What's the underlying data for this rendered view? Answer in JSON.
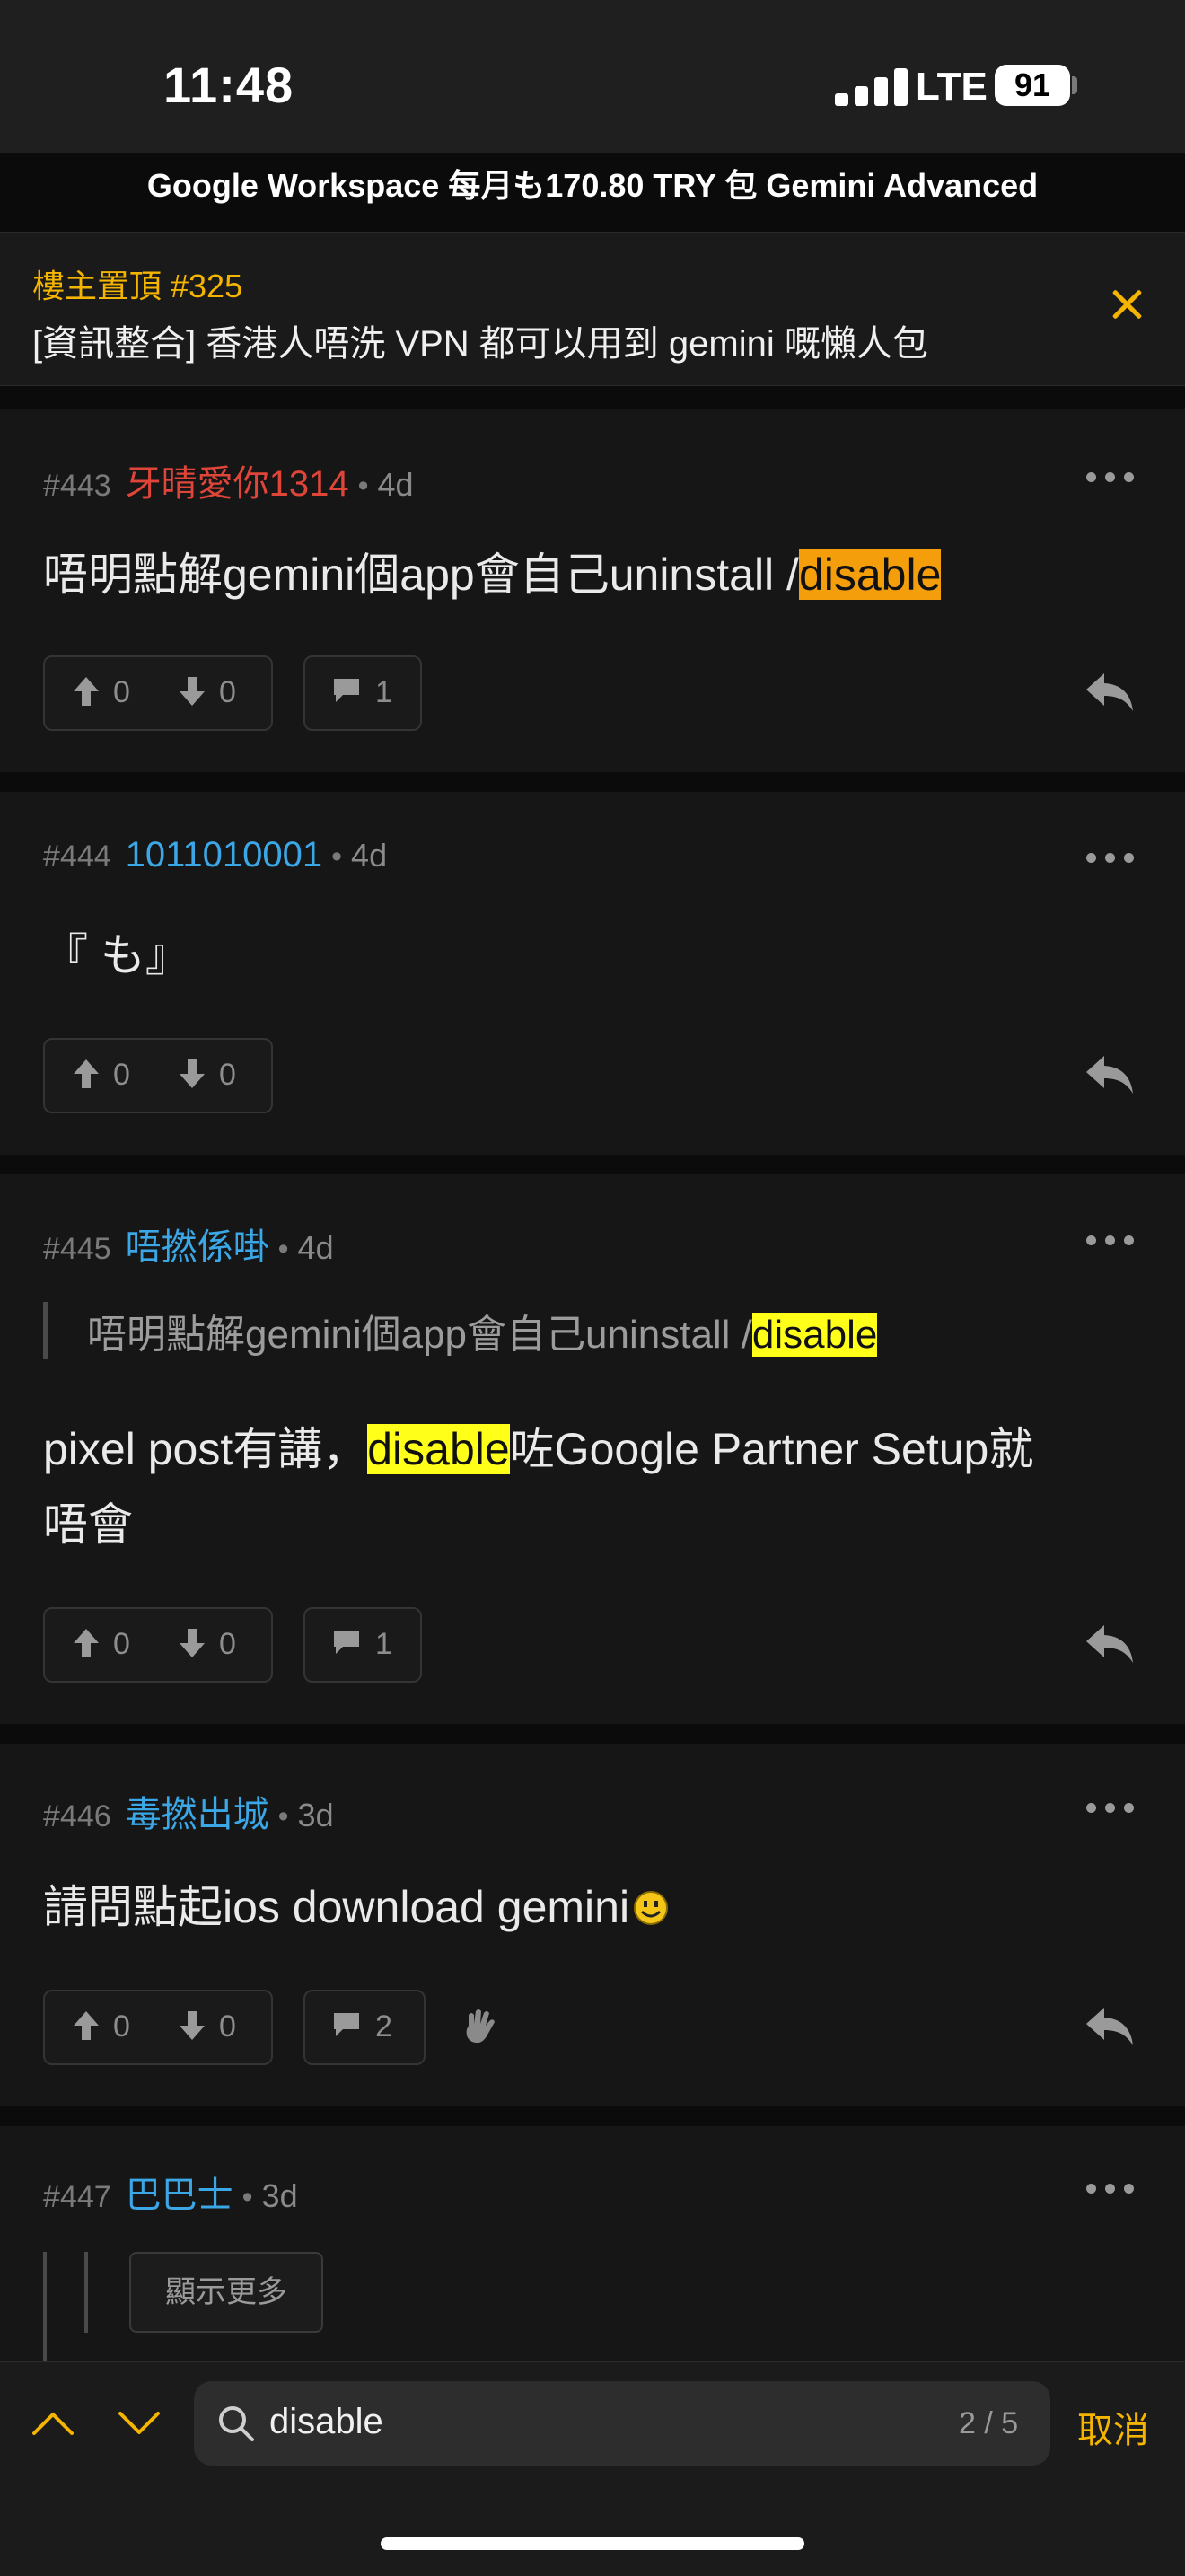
{
  "status": {
    "time": "11:48",
    "network": "LTE",
    "battery": "91"
  },
  "header": {
    "title": "Google Workspace 每月も170.80 TRY 包 Gemini Advanced"
  },
  "pinned": {
    "label": "樓主置頂 #325",
    "text": "[資訊整合] 香港人唔洗 VPN 都可以用到 gemini 嘅懶人包"
  },
  "posts": [
    {
      "num": "#443",
      "user": "牙晴愛你1314",
      "age": "4d",
      "body_pre": "唔明點解gemini個app會自己uninstall /",
      "body_hl": "disable",
      "up": "0",
      "down": "0",
      "comments": "1"
    },
    {
      "num": "#444",
      "user": "1011010001",
      "age": "4d",
      "body": "『 も』",
      "up": "0",
      "down": "0"
    },
    {
      "num": "#445",
      "user": "唔撚係啩",
      "age": "4d",
      "quote_pre": "唔明點解gemini個app會自己uninstall /",
      "quote_hl": "disable",
      "body_pre": "pixel post有講，",
      "body_hl": "disable",
      "body_post": "咗Google Partner Setup就",
      "body_line2": "唔會",
      "up": "0",
      "down": "0",
      "comments": "1"
    },
    {
      "num": "#446",
      "user": "毒撚出城",
      "age": "3d",
      "body": "請問點起ios download gemini",
      "up": "0",
      "down": "0",
      "comments": "2"
    },
    {
      "num": "#447",
      "user": "巴巴士",
      "age": "3d",
      "show_more": "顯示更多"
    }
  ],
  "colors": {
    "accent": "#f4b400",
    "user_red": "#e0453a",
    "user_blue": "#3ba7e6",
    "current_highlight": "#f59e0b",
    "highlight": "#ffff1a"
  },
  "search": {
    "query": "disable",
    "count": "2 / 5",
    "cancel_label": "取消"
  }
}
